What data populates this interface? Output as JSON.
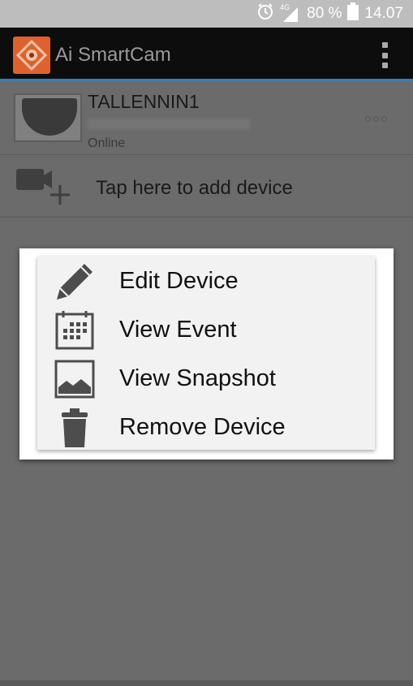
{
  "status_bar": {
    "network": "4G",
    "battery": "80 %",
    "time": "14.07",
    "icons": [
      "alarm-icon",
      "signal-icon",
      "battery-icon"
    ]
  },
  "app_bar": {
    "title": "Ai SmartCam",
    "accent_color": "#3a7cb5",
    "logo_color": "#e0612f"
  },
  "device_list": [
    {
      "name": "TALLENNIN1",
      "status": "Online",
      "more": "○○○"
    }
  ],
  "add_device": {
    "label": "Tap here to add device"
  },
  "context_menu": {
    "items": [
      {
        "label": "Edit Device",
        "icon": "pencil-icon"
      },
      {
        "label": "View Event",
        "icon": "calendar-icon"
      },
      {
        "label": "View Snapshot",
        "icon": "image-icon"
      },
      {
        "label": "Remove Device",
        "icon": "trash-icon"
      }
    ]
  }
}
